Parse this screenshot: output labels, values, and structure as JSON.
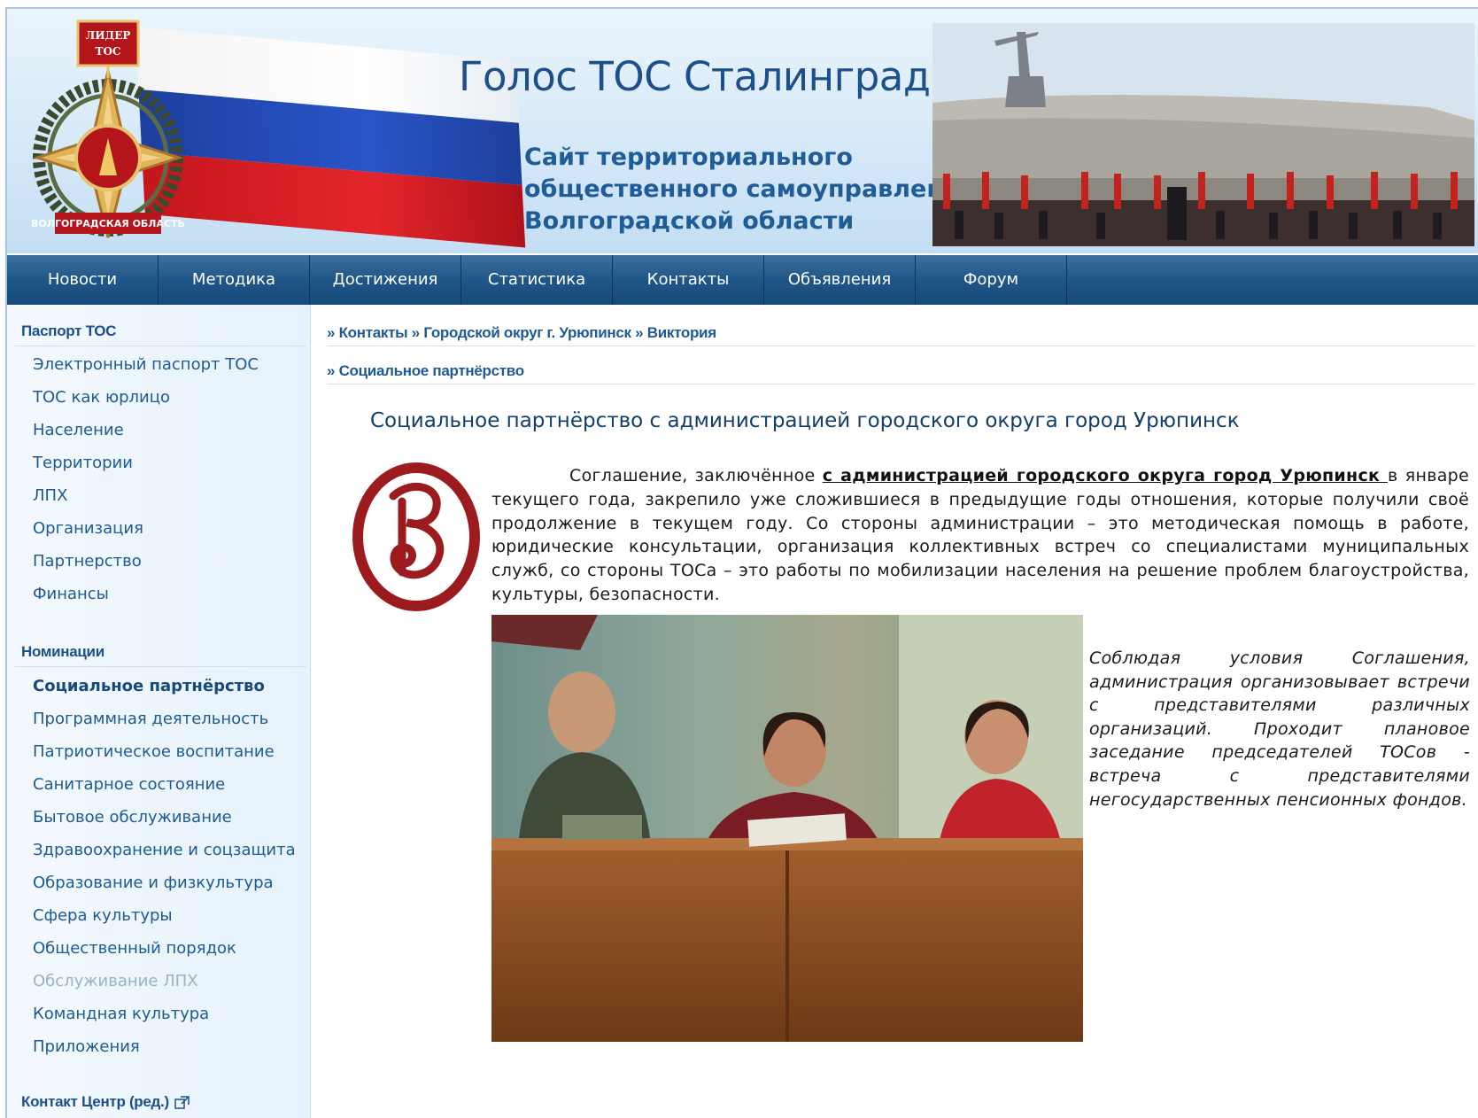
{
  "header": {
    "title": "Голос ТОС Сталинграда",
    "subtitle_lines": [
      "Сайт территориального",
      "общественного самоуправления",
      "Волгоградской области"
    ],
    "emblem": {
      "top_text": "ЛИДЕР ТОС",
      "bottom_text": "ВОЛГОГРАДСКАЯ ОБЛАСТЬ"
    }
  },
  "nav": {
    "items": [
      {
        "label": "Новости"
      },
      {
        "label": "Методика"
      },
      {
        "label": "Достижения"
      },
      {
        "label": "Статистика"
      },
      {
        "label": "Контакты"
      },
      {
        "label": "Объявления"
      },
      {
        "label": "Форум"
      }
    ]
  },
  "sidebar": {
    "passport_heading": "Паспорт ТОС",
    "passport_items": [
      {
        "label": "Электронный паспорт ТОС"
      },
      {
        "label": "ТОС как юрлицо"
      },
      {
        "label": "Население"
      },
      {
        "label": "Территории"
      },
      {
        "label": "ЛПХ"
      },
      {
        "label": "Организация"
      },
      {
        "label": "Партнерство"
      },
      {
        "label": "Финансы"
      }
    ],
    "nominations_heading": "Номинации",
    "nomination_items": [
      {
        "label": "Социальное партнёрство",
        "state": "active"
      },
      {
        "label": "Программная деятельность"
      },
      {
        "label": "Патриотическое воспитание"
      },
      {
        "label": "Санитарное состояние"
      },
      {
        "label": "Бытовое обслуживание"
      },
      {
        "label": "Здравоохранение и соцзащита"
      },
      {
        "label": "Образование и физкультура"
      },
      {
        "label": "Сфера культуры"
      },
      {
        "label": "Общественный порядок"
      },
      {
        "label": "Обслуживание ЛПХ",
        "state": "dim"
      },
      {
        "label": "Командная культура"
      },
      {
        "label": "Приложения"
      }
    ],
    "contact_heading": "Контакт Центр (ред.)"
  },
  "breadcrumb": {
    "path": "» Контакты » Городской округ г. Урюпинск » Виктория",
    "section": "» Социальное партнёрство"
  },
  "article": {
    "title": "Социальное партнёрство с администрацией городского округа город Урюпинск",
    "para_before_link": "Соглашение, заключённое ",
    "para_link": "с администрацией городского округа город Урюпинск ",
    "para_after_link": "в январе текущего года, закрепило  уже сложившиеся  в предыдущие годы отношения, которые получили своё продолжение в текущем году. Со стороны администрации – это методическая помощь в работе, юридические консультации, организация коллективных встреч со специалистами  муниципальных служб, со стороны ТОСа – это работы по мобилизации населения на решение проблем благоустройства, культуры, безопасности.",
    "caption": "Соблюдая условия Соглашения, администрация организовывает встречи с представителями различных организаций. Проходит плановое заседание председателей ТОСов - встреча с представителями негосударственных пенсионных фондов."
  },
  "colors": {
    "nav_bg": "#1f5688",
    "link": "#1f5a92",
    "title": "#1c4f8c",
    "logo_red": "#9b1b1e"
  }
}
